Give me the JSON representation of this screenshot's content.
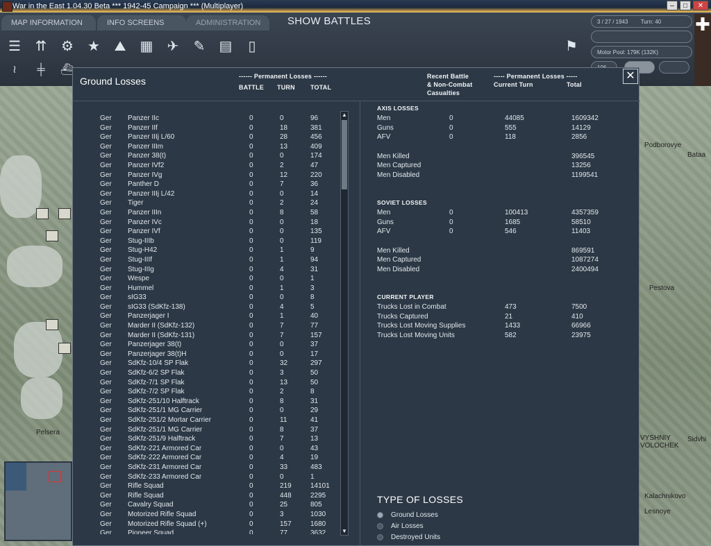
{
  "window": {
    "title": "War in the East 1.04.30 Beta      ***   1942-45 Campaign   ***   (Multiplayer)"
  },
  "menu": {
    "map_information": "MAP INFORMATION",
    "info_screens": "INFO SCREENS",
    "administration": "ADMINISTRATION",
    "show_battles": "SHOW BATTLES"
  },
  "status": {
    "date": "3 / 27 / 1943",
    "turn": "Turn: 40",
    "motor_pool": "Motor Pool:  179K (132K)",
    "small_value": "106"
  },
  "dialog": {
    "title": "Ground Losses",
    "left_header_group": "------ Permanent Losses ------",
    "col_battle": "BATTLE",
    "col_turn": "TURN",
    "col_total": "TOTAL",
    "recent_header": "Recent Battle\n& Non-Combat\nCasualties",
    "recent_l1": "Recent Battle",
    "recent_l2": "& Non-Combat",
    "recent_l3": "Casualties",
    "right_header_group": "----- Permanent Losses -----",
    "col_current_turn": "Current Turn",
    "col_total_right": "Total",
    "close": "✕"
  },
  "ground_losses": [
    [
      "Ger",
      "Panzer IIc",
      "0",
      "0",
      "96"
    ],
    [
      "Ger",
      "Panzer IIf",
      "0",
      "18",
      "381"
    ],
    [
      "Ger",
      "Panzer IIIj L/60",
      "0",
      "28",
      "456"
    ],
    [
      "Ger",
      "Panzer IIIm",
      "0",
      "13",
      "409"
    ],
    [
      "Ger",
      "Panzer 38(t)",
      "0",
      "0",
      "174"
    ],
    [
      "Ger",
      "Panzer IVf2",
      "0",
      "2",
      "47"
    ],
    [
      "Ger",
      "Panzer IVg",
      "0",
      "12",
      "220"
    ],
    [
      "Ger",
      "Panther D",
      "0",
      "7",
      "36"
    ],
    [
      "Ger",
      "Panzer IIIj L/42",
      "0",
      "0",
      "14"
    ],
    [
      "Ger",
      "Tiger",
      "0",
      "2",
      "24"
    ],
    [
      "Ger",
      "Panzer IIIn",
      "0",
      "8",
      "58"
    ],
    [
      "Ger",
      "Panzer IVc",
      "0",
      "0",
      "18"
    ],
    [
      "Ger",
      "Panzer IVf",
      "0",
      "0",
      "135"
    ],
    [
      "Ger",
      "Stug-IIIb",
      "0",
      "0",
      "119"
    ],
    [
      "Ger",
      "Stug-H42",
      "0",
      "1",
      "9"
    ],
    [
      "Ger",
      "Stug-IIIf",
      "0",
      "1",
      "94"
    ],
    [
      "Ger",
      "Stug-IIIg",
      "0",
      "4",
      "31"
    ],
    [
      "Ger",
      "Wespe",
      "0",
      "0",
      "1"
    ],
    [
      "Ger",
      "Hummel",
      "0",
      "1",
      "3"
    ],
    [
      "Ger",
      "sIG33",
      "0",
      "0",
      "8"
    ],
    [
      "Ger",
      "sIG33 (SdKfz-138)",
      "0",
      "4",
      "5"
    ],
    [
      "Ger",
      "Panzerjager I",
      "0",
      "1",
      "40"
    ],
    [
      "Ger",
      "Marder II (SdKfz-132)",
      "0",
      "7",
      "77"
    ],
    [
      "Ger",
      "Marder II (SdKfz-131)",
      "0",
      "7",
      "157"
    ],
    [
      "Ger",
      "Panzerjager 38(t)",
      "0",
      "0",
      "37"
    ],
    [
      "Ger",
      "Panzerjager 38(t)H",
      "0",
      "0",
      "17"
    ],
    [
      "Ger",
      "SdKfz-10/4 SP Flak",
      "0",
      "32",
      "297"
    ],
    [
      "Ger",
      "SdKfz-6/2 SP Flak",
      "0",
      "3",
      "50"
    ],
    [
      "Ger",
      "SdKfz-7/1 SP Flak",
      "0",
      "13",
      "50"
    ],
    [
      "Ger",
      "SdKfz-7/2 SP Flak",
      "0",
      "2",
      "8"
    ],
    [
      "Ger",
      "SdKfz-251/10 Halftrack",
      "0",
      "8",
      "31"
    ],
    [
      "Ger",
      "SdKfz-251/1 MG Carrier",
      "0",
      "0",
      "29"
    ],
    [
      "Ger",
      "SdKfz-251/2 Mortar Carrier",
      "0",
      "11",
      "41"
    ],
    [
      "Ger",
      "SdKfz-251/1 MG Carrier",
      "0",
      "8",
      "37"
    ],
    [
      "Ger",
      "SdKfz-251/9 Halftrack",
      "0",
      "7",
      "13"
    ],
    [
      "Ger",
      "SdKfz-221 Armored Car",
      "0",
      "0",
      "43"
    ],
    [
      "Ger",
      "SdKfz-222 Armored Car",
      "0",
      "4",
      "19"
    ],
    [
      "Ger",
      "SdKfz-231 Armored Car",
      "0",
      "33",
      "483"
    ],
    [
      "Ger",
      "SdKfz-233 Armored Car",
      "0",
      "0",
      "1"
    ],
    [
      "Ger",
      "Rifle Squad",
      "0",
      "219",
      "14101"
    ],
    [
      "Ger",
      "Rifle Squad",
      "0",
      "448",
      "2295"
    ],
    [
      "Ger",
      "Cavalry Squad",
      "0",
      "25",
      "805"
    ],
    [
      "Ger",
      "Motorized Rifle Squad",
      "0",
      "3",
      "1030"
    ],
    [
      "Ger",
      "Motorized Rifle Squad (+)",
      "0",
      "157",
      "1680"
    ],
    [
      "Ger",
      "Pioneer Squad",
      "0",
      "77",
      "3632"
    ]
  ],
  "axis_losses": {
    "title": "AXIS LOSSES",
    "rows": [
      [
        "Men",
        "0",
        "44085",
        "1609342"
      ],
      [
        "Guns",
        "0",
        "555",
        "14129"
      ],
      [
        "AFV",
        "0",
        "118",
        "2856"
      ]
    ],
    "casualties": [
      [
        "Men Killed",
        "396545"
      ],
      [
        "Men Captured",
        "13256"
      ],
      [
        "Men Disabled",
        "1199541"
      ]
    ]
  },
  "soviet_losses": {
    "title": "SOVIET LOSSES",
    "rows": [
      [
        "Men",
        "0",
        "100413",
        "4357359"
      ],
      [
        "Guns",
        "0",
        "1685",
        "58510"
      ],
      [
        "AFV",
        "0",
        "546",
        "11403"
      ]
    ],
    "casualties": [
      [
        "Men Killed",
        "869591"
      ],
      [
        "Men Captured",
        "1087274"
      ],
      [
        "Men Disabled",
        "2400494"
      ]
    ]
  },
  "current_player": {
    "title": "CURRENT PLAYER",
    "rows": [
      [
        "Trucks Lost in Combat",
        "473",
        "7500"
      ],
      [
        "Trucks Captured",
        "21",
        "410"
      ],
      [
        "Trucks Lost Moving Supplies",
        "1433",
        "66966"
      ],
      [
        "Trucks Lost Moving Units",
        "582",
        "23975"
      ]
    ]
  },
  "type_of_losses": {
    "title": "TYPE OF LOSSES",
    "options": [
      "Ground Losses",
      "Air Losses",
      "Destroyed Units"
    ],
    "selected": "Ground Losses"
  },
  "map_labels": [
    "Podborovye",
    "Bataa",
    "Pestova",
    "VYSHNIY VOLOCHEK",
    "Kalachnikovo",
    "Lesnoye",
    "Pelsera",
    "Sidvhi"
  ],
  "colors": {
    "dialog_bg": "#2c3845",
    "accent": "#f2f5f8",
    "map": "#8b9886"
  }
}
